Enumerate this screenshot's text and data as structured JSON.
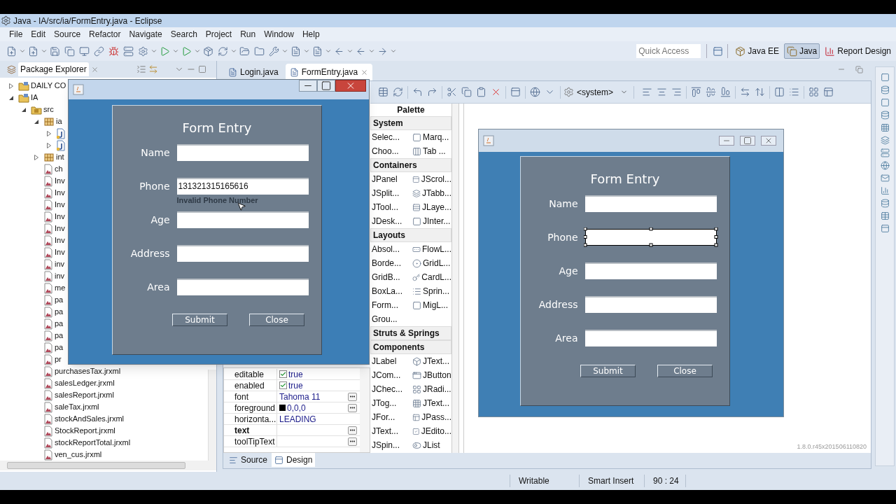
{
  "window": {
    "title": "Java - IA/src/ia/FormEntry.java - Eclipse"
  },
  "menu": [
    "File",
    "Edit",
    "Source",
    "Refactor",
    "Navigate",
    "Search",
    "Project",
    "Run",
    "Window",
    "Help"
  ],
  "quick_access": {
    "placeholder": "Quick Access"
  },
  "perspectives": [
    {
      "label": "Java EE",
      "selected": false
    },
    {
      "label": "Java",
      "selected": true
    },
    {
      "label": "Report Design",
      "selected": false
    }
  ],
  "package_explorer": {
    "title": "Package Explorer",
    "tree": [
      {
        "label": "DAILY CO",
        "kind": "project",
        "expanded": false
      },
      {
        "label": "IA",
        "kind": "project",
        "expanded": true,
        "children": [
          {
            "label": "src",
            "kind": "source",
            "expanded": true,
            "children": [
              {
                "label": "ia",
                "kind": "package",
                "expanded": true,
                "children": [
                  {
                    "kind": "class",
                    "expanded": false
                  },
                  {
                    "kind": "class",
                    "expanded": false
                  }
                ]
              },
              {
                "label": "int",
                "kind": "package",
                "expanded": false
              },
              {
                "label": "ch",
                "kind": "report"
              },
              {
                "label": "Inv",
                "kind": "report"
              },
              {
                "label": "Inv",
                "kind": "report"
              },
              {
                "label": "Inv",
                "kind": "report"
              },
              {
                "label": "Inv",
                "kind": "report"
              },
              {
                "label": "Inv",
                "kind": "report"
              },
              {
                "label": "Inv",
                "kind": "report"
              },
              {
                "label": "Inv",
                "kind": "report"
              },
              {
                "label": "inv",
                "kind": "report"
              },
              {
                "label": "inv",
                "kind": "report"
              },
              {
                "label": "me",
                "kind": "report"
              },
              {
                "label": "pa",
                "kind": "report"
              },
              {
                "label": "pa",
                "kind": "report"
              },
              {
                "label": "pa",
                "kind": "report"
              },
              {
                "label": "pa",
                "kind": "report"
              },
              {
                "label": "pa",
                "kind": "report"
              },
              {
                "label": "pr",
                "kind": "report"
              },
              {
                "label": "purchasesTax.jrxml",
                "kind": "report"
              },
              {
                "label": "salesLedger.jrxml",
                "kind": "report"
              },
              {
                "label": "salesReport.jrxml",
                "kind": "report"
              },
              {
                "label": "saleTax.jrxml",
                "kind": "report"
              },
              {
                "label": "stockAndSales.jrxml",
                "kind": "report"
              },
              {
                "label": "StockReport.jrxml",
                "kind": "report"
              },
              {
                "label": "stockReportTotal.jrxml",
                "kind": "report"
              },
              {
                "label": "ven_cus.jrxml",
                "kind": "report"
              }
            ]
          }
        ]
      }
    ]
  },
  "editor": {
    "tabs": [
      {
        "label": "Login.java",
        "selected": false
      },
      {
        "label": "FormEntry.java",
        "selected": true
      }
    ],
    "system_combo": "<system>",
    "palette": {
      "title": "Palette",
      "groups": [
        {
          "name": "System",
          "items": [
            "Selec...",
            "Marq...",
            "Choo...",
            "Tab ..."
          ]
        },
        {
          "name": "Containers",
          "items": [
            "JPanel",
            "JScrol...",
            "JSplit...",
            "JTabb...",
            "JTool...",
            "JLaye...",
            "JDesk...",
            "JInter..."
          ]
        },
        {
          "name": "Layouts",
          "items": [
            "Absol...",
            "FlowL...",
            "Borde...",
            "GridL...",
            "GridB...",
            "CardL...",
            "BoxLa...",
            "Sprin...",
            "Form...",
            "MigL...",
            "Grou..."
          ]
        },
        {
          "name": "Struts & Springs"
        },
        {
          "name": "Components",
          "items": [
            "JLabel",
            "JText...",
            "JCom...",
            "JButton",
            "JChec...",
            "JRadi...",
            "JTog...",
            "JText...",
            "JFor...",
            "JPass...",
            "JText...",
            "JEdito...",
            "JSpin...",
            "JList"
          ]
        }
      ]
    },
    "properties": [
      {
        "name": "editable",
        "value": "true",
        "kind": "boolean",
        "checked": true,
        "bold": false,
        "has_button": false
      },
      {
        "name": "enabled",
        "value": "true",
        "kind": "boolean",
        "checked": true,
        "bold": false,
        "has_button": false
      },
      {
        "name": "font",
        "value": "Tahoma 11",
        "kind": "text",
        "bold": false,
        "has_button": true
      },
      {
        "name": "foreground",
        "value": "0,0,0",
        "kind": "color",
        "color": "#000000",
        "bold": false,
        "has_button": true
      },
      {
        "name": "horizonta...",
        "value": "LEADING",
        "kind": "text",
        "bold": false,
        "has_button": false
      },
      {
        "name": "text",
        "kind": "text",
        "bold": true,
        "has_button": true
      },
      {
        "name": "toolTipText",
        "kind": "text",
        "bold": false,
        "has_button": true
      }
    ],
    "design_form": {
      "title": "Form Entry",
      "fields": [
        {
          "label": "Name",
          "selected": false
        },
        {
          "label": "Phone",
          "selected": true
        },
        {
          "label": "Age",
          "selected": false
        },
        {
          "label": "Address",
          "selected": false
        },
        {
          "label": "Area",
          "selected": false
        }
      ],
      "buttons": [
        "Submit",
        "Close"
      ]
    },
    "version": "1.8.0.r45x201506110820",
    "bottom_tabs": [
      {
        "label": "Source",
        "selected": false
      },
      {
        "label": "Design",
        "selected": true
      }
    ]
  },
  "running_app": {
    "title": "Form Entry",
    "fields": [
      {
        "label": "Name"
      },
      {
        "label": "Phone",
        "value": "131321315165616",
        "error": "Invalid Phone Number"
      },
      {
        "label": "Age"
      },
      {
        "label": "Address"
      },
      {
        "label": "Area"
      }
    ],
    "buttons": [
      "Submit",
      "Close"
    ]
  },
  "status_bar": [
    "Writable",
    "Smart Insert",
    "90 : 24"
  ]
}
